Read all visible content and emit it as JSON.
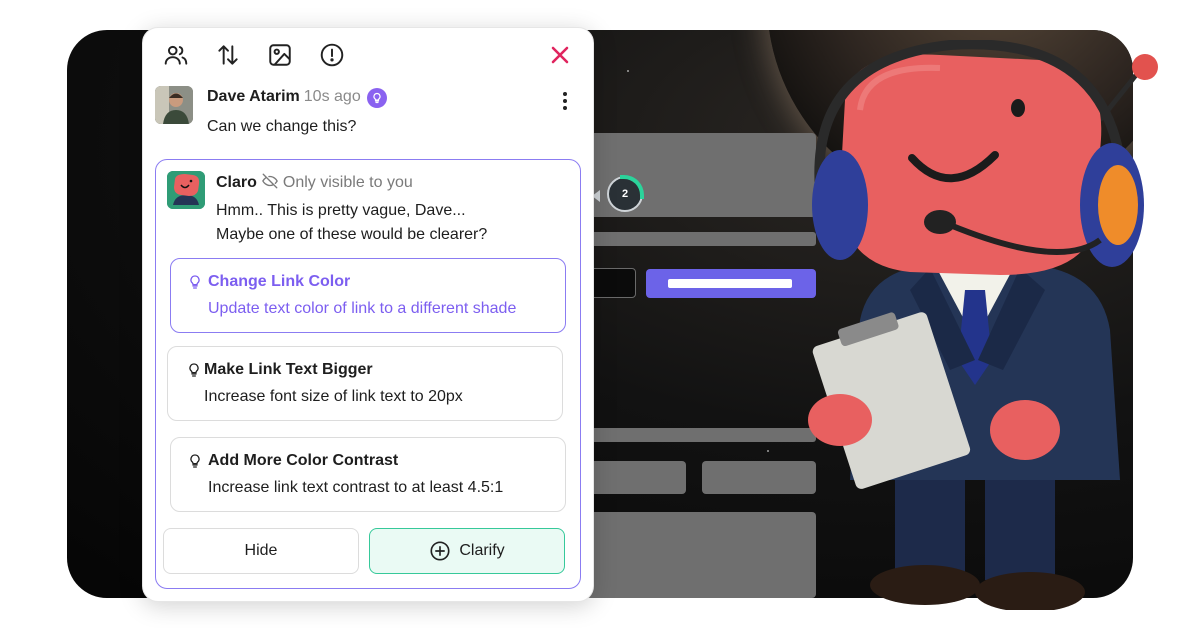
{
  "toolbar": {
    "icons": [
      "users-icon",
      "sort-icon",
      "image-icon",
      "alert-icon"
    ],
    "close_icon": "close-icon",
    "accent": "#e0245e"
  },
  "comment": {
    "author": "Dave Atarim",
    "time": "10s ago",
    "text": "Can we change this?"
  },
  "reply": {
    "name": "Claro",
    "visibility": "Only visible to you",
    "message_line1": "Hmm.. This is pretty vague, Dave...",
    "message_line2": "Maybe one of these would be clearer?",
    "suggestions": [
      {
        "title": "Change Link Color",
        "description": "Update text color of link to a different shade"
      },
      {
        "title": "Make Link Text Bigger",
        "description": "Increase font size of link text to 20px"
      },
      {
        "title": "Add More Color Contrast",
        "description": "Increase link text contrast to at least 4.5:1"
      }
    ],
    "hide_label": "Hide",
    "clarify_label": "Clarify"
  },
  "background": {
    "pin_number": "2"
  },
  "colors": {
    "accent_purple": "#7c5ef0",
    "accent_green": "#36c99a",
    "close_red": "#e0245e"
  }
}
